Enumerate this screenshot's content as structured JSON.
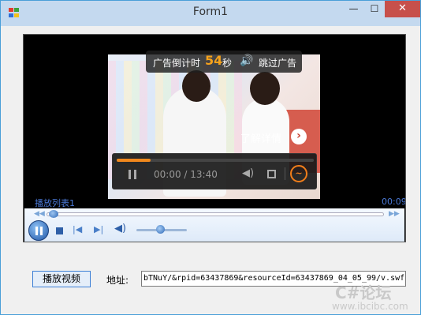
{
  "window": {
    "title": "Form1",
    "minimize": "—",
    "maximize": "☐",
    "close": "✕"
  },
  "ad": {
    "countdown_label": "广告倒计时",
    "countdown_value": "54",
    "seconds_unit": "秒",
    "skip_label": "跳过广告",
    "learn_more": "了解详情",
    "speaker_icon": "🔊"
  },
  "inner_player": {
    "time": "00:00 / 13:40",
    "progress_fraction": 0.17
  },
  "wmp": {
    "playlist_label": "播放列表1",
    "elapsed": "00:09",
    "seek_fraction": 0.02,
    "volume_fraction": 0.5
  },
  "form": {
    "play_button": "播放视频",
    "address_label": "地址:",
    "address_value": "bTNuY/&rpid=63437869&resourceId=63437869_04_05_99/v.swf"
  },
  "watermark": {
    "big": "C#论坛",
    "small": "www.ibcibc.com"
  }
}
